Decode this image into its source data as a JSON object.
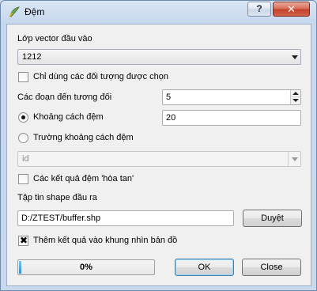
{
  "window": {
    "title": "Đệm",
    "help_label": "?",
    "close_label": "✕"
  },
  "form": {
    "input_layer_label": "Lớp vector đầu vào",
    "input_layer_value": "1212",
    "selected_only_label": "Chỉ dùng các đối tượng được chọn",
    "selected_only_checked": false,
    "segments_label": "Các đoạn đến tương đối",
    "segments_value": "5",
    "buffer_distance_label": "Khoảng cách đệm",
    "buffer_distance_value": "20",
    "buffer_distance_selected": true,
    "buffer_field_label": "Trường khoảng cách đệm",
    "buffer_field_selected": false,
    "buffer_field_value": "id",
    "dissolve_label": "Các kết quả đệm 'hòa tan'",
    "dissolve_checked": false,
    "output_label": "Tập tin shape đầu ra",
    "output_value": "D:/ZTEST/buffer.shp",
    "browse_label": "Duyệt",
    "add_to_map_label": "Thêm kết quả vào khung nhìn bản đồ",
    "add_to_map_checked": true,
    "add_to_map_mark": "✖"
  },
  "footer": {
    "progress_text": "0%",
    "progress_value": 0,
    "ok_label": "OK",
    "close_label": "Close"
  },
  "colors": {
    "progress_fill": "#2d8fd1",
    "titlebar": "#c7d7ec",
    "close_button": "#c2412a"
  }
}
